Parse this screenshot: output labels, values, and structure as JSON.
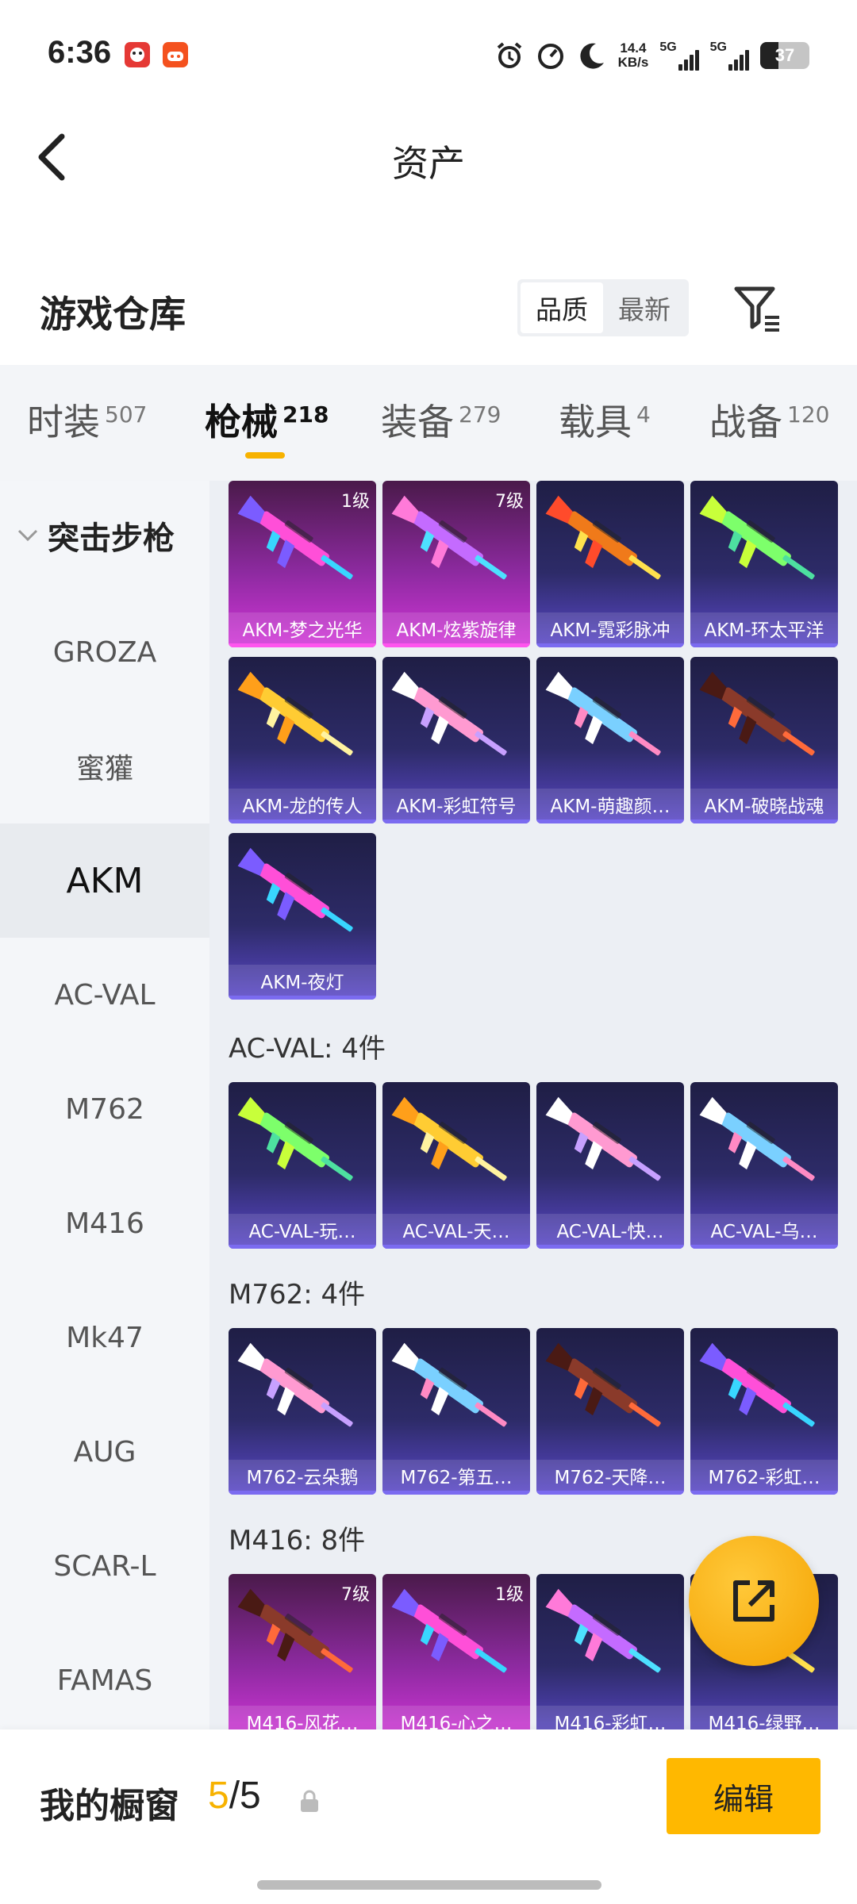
{
  "status_bar": {
    "time": "6:36",
    "net_speed": "14.4",
    "net_unit": "KB/s",
    "signal_1": "5G",
    "signal_2": "5G",
    "battery": "37",
    "battery_level": 0.37
  },
  "header": {
    "title": "资产"
  },
  "section": {
    "title": "游戏仓库",
    "sort_options": [
      "品质",
      "最新"
    ],
    "sort_selected": "品质"
  },
  "tabs": [
    {
      "label": "时装",
      "count": "507"
    },
    {
      "label": "枪械",
      "count": "218",
      "active": true
    },
    {
      "label": "装备",
      "count": "279"
    },
    {
      "label": "载具",
      "count": "4"
    },
    {
      "label": "战备",
      "count": "120"
    }
  ],
  "sidebar": {
    "group": "突击步枪",
    "items": [
      "GROZA",
      "蜜獾",
      "AKM",
      "AC-VAL",
      "M762",
      "M416",
      "Mk47",
      "AUG",
      "SCAR-L",
      "FAMAS"
    ],
    "active": "AKM"
  },
  "content": {
    "akm_cards": [
      {
        "name": "AKM-梦之光华",
        "level": "1级",
        "style": "pink"
      },
      {
        "name": "AKM-炫紫旋律",
        "level": "7级",
        "style": "pink"
      },
      {
        "name": "AKM-霓彩脉冲",
        "level": "",
        "style": "purple"
      },
      {
        "name": "AKM-环太平洋",
        "level": "",
        "style": "purple"
      },
      {
        "name": "AKM-龙的传人",
        "level": "",
        "style": "purple"
      },
      {
        "name": "AKM-彩虹符号",
        "level": "",
        "style": "purple"
      },
      {
        "name": "AKM-萌趣颜…",
        "level": "",
        "style": "purple"
      },
      {
        "name": "AKM-破晓战魂",
        "level": "",
        "style": "purple"
      },
      {
        "name": "AKM-夜灯",
        "level": "",
        "style": "purple"
      }
    ],
    "acval_label": "AC-VAL: 4件",
    "acval_cards": [
      {
        "name": "AC-VAL-玩…",
        "style": "purple"
      },
      {
        "name": "AC-VAL-天…",
        "style": "purple"
      },
      {
        "name": "AC-VAL-快…",
        "style": "purple"
      },
      {
        "name": "AC-VAL-乌…",
        "style": "purple"
      }
    ],
    "m762_label": "M762: 4件",
    "m762_cards": [
      {
        "name": "M762-云朵鹅",
        "style": "purple"
      },
      {
        "name": "M762-第五…",
        "style": "purple"
      },
      {
        "name": "M762-天降…",
        "style": "purple"
      },
      {
        "name": "M762-彩虹…",
        "style": "purple"
      }
    ],
    "m416_label": "M416: 8件",
    "m416_cards": [
      {
        "name": "M416-风花…",
        "level": "7级",
        "style": "pink"
      },
      {
        "name": "M416-心之…",
        "level": "1级",
        "style": "pink"
      },
      {
        "name": "M416-彩虹…",
        "level": "",
        "style": "purple"
      },
      {
        "name": "M416-绿野…",
        "level": "",
        "style": "purple"
      }
    ]
  },
  "bottom_bar": {
    "label": "我的橱窗",
    "count_current": "5",
    "count_sep": "/",
    "count_total": "5",
    "edit_label": "编辑"
  }
}
